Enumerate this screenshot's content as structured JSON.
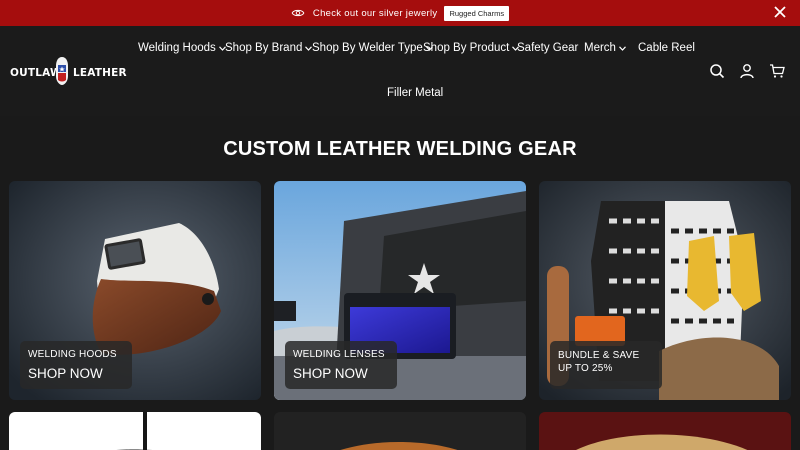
{
  "announcement": {
    "icon": "eye-icon",
    "message": "Check out our silver jewerly",
    "button_label": "Rugged Charms",
    "close_icon": "close-icon",
    "background": "#a50d0d"
  },
  "logo": {
    "word_left": "OUTLAW",
    "word_right": "LEATHER",
    "emblem": "texas-emblem-icon"
  },
  "nav": {
    "items": [
      {
        "label": "Welding Hoods",
        "has_dropdown": true
      },
      {
        "label": "Shop By Brand",
        "has_dropdown": true
      },
      {
        "label": "Shop By Welder Type",
        "has_dropdown": true
      },
      {
        "label": "Shop By Product",
        "has_dropdown": true
      },
      {
        "label": "Safety Gear",
        "has_dropdown": false
      },
      {
        "label": "Merch",
        "has_dropdown": true
      },
      {
        "label": "Cable Reel",
        "has_dropdown": false
      },
      {
        "label": "Filler Metal",
        "has_dropdown": false
      }
    ]
  },
  "header_icons": [
    "search-icon",
    "account-icon",
    "cart-icon"
  ],
  "page_title": "CUSTOM LEATHER WELDING GEAR",
  "cards": [
    {
      "title": "WELDING HOODS",
      "cta": "SHOP NOW",
      "image": "leather-welding-hood"
    },
    {
      "title": "WELDING LENSES",
      "cta": "SHOP NOW",
      "image": "welding-lens-on-truck"
    },
    {
      "title": "BUNDLE & SAVE UP TO 25%",
      "cta": "",
      "image": "shirt-gloves-bundle"
    }
  ]
}
